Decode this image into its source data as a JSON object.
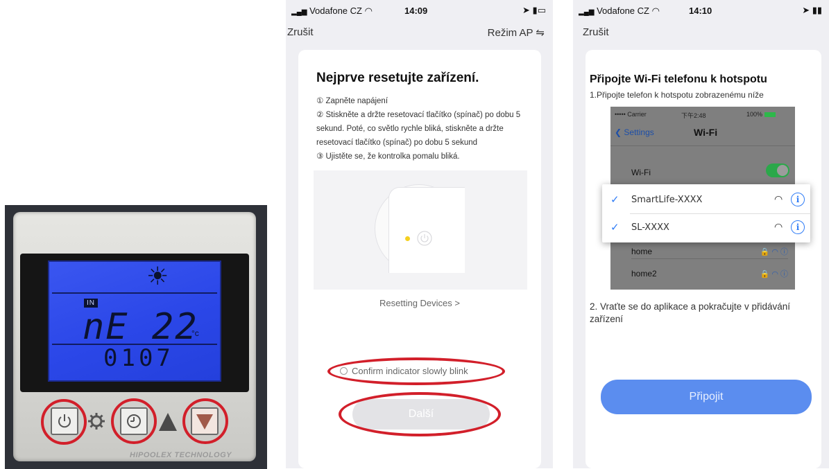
{
  "thermostat_photo": {
    "lcd_mode": "IN",
    "lcd_main": "nE 22",
    "lcd_unit": "°c",
    "lcd_bottom": "0107",
    "brand_text": "HIPOOLEX TECHNOLOGY",
    "icons": [
      "power-icon",
      "gear-icon",
      "clock-icon",
      "arrow-up-icon",
      "arrow-down-icon"
    ],
    "highlight_color": "#d21f2a"
  },
  "phone1": {
    "status": {
      "carrier": "Vodafone CZ",
      "time": "14:09"
    },
    "nav": {
      "cancel": "Zrušit",
      "mode": "Režim AP ⇋"
    },
    "title": "Nejprve resetujte zařízení.",
    "steps": [
      "① Zapněte napájení",
      "② Stiskněte a držte resetovací tlačítko (spínač) po dobu 5 sekund. Poté, co světlo rychle bliká, stiskněte a držte resetovací tlačítko (spínač) po dobu 5 sekund",
      "③ Ujistěte se, že kontrolka pomalu bliká."
    ],
    "link": "Resetting Devices >",
    "confirm_label": "Confirm indicator slowly blink",
    "next_button": "Další"
  },
  "phone2": {
    "status": {
      "carrier": "Vodafone CZ",
      "time": "14:10"
    },
    "nav": {
      "cancel": "Zrušit"
    },
    "title": "Připojte Wi-Fi telefonu k hotspotu",
    "step1": "1.Připojte telefon k hotspotu zobrazenému níže",
    "ios_status": {
      "carrier": "••••• Carrier",
      "time": "下午2:48",
      "battery": "100%"
    },
    "ios_nav": {
      "back": "Settings",
      "title": "Wi-Fi"
    },
    "wifi_label": "Wi-Fi",
    "networks_highlight": [
      "SmartLife-XXXX",
      "SL-XXXX"
    ],
    "networks_other": [
      "home",
      "home2"
    ],
    "step2": "2. Vraťte se do aplikace a pokračujte v přidávání zařízení",
    "connect_button": "Připojit",
    "accent": "#5b8def"
  }
}
